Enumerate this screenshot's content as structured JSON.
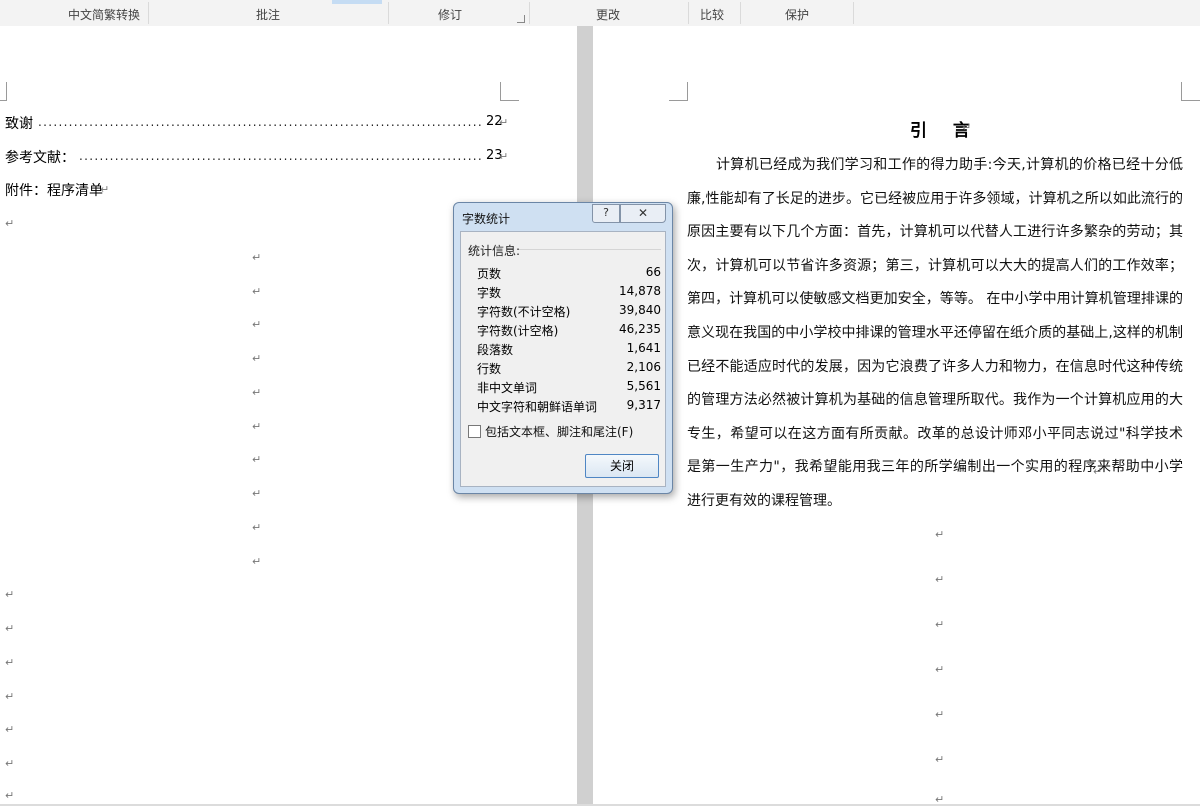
{
  "ribbon": {
    "groups": [
      "中文简繁转换",
      "批注",
      "修订",
      "更改",
      "比较",
      "保护"
    ]
  },
  "left_page": {
    "toc": [
      {
        "label": "致谢",
        "page": "22"
      },
      {
        "label": "参考文献：",
        "page": "23"
      }
    ],
    "appendix": "附件：程序清单",
    "para_mark": "↵"
  },
  "right_page": {
    "heading": "引  言",
    "para_mark": "↵",
    "body": "计算机已经成为我们学习和工作的得力助手:今天,计算机的价格已经十分低廉,性能却有了长足的进步。它已经被应用于许多领域，计算机之所以如此流行的原因主要有以下几个方面：首先，计算机可以代替人工进行许多繁杂的劳动；其次，计算机可以节省许多资源；第三，计算机可以大大的提高人们的工作效率；第四，计算机可以使敏感文档更加安全，等等。 在中小学中用计算机管理排课的意义现在我国的中小学校中排课的管理水平还停留在纸介质的基础上,这样的机制已经不能适应时代的发展，因为它浪费了许多人力和物力，在信息时代这种传统的管理方法必然被计算机为基础的信息管理所取代。我作为一个计算机应用的大专生，希望可以在这方面有所贡献。改革的总设计师邓小平同志说过\"科学技术是第一生产力\"，我希望能用我三年的所学编制出一个实用的程序来帮助中小学进行更有效的课程管理。"
  },
  "dialog": {
    "title": "字数统计",
    "help_icon": "?",
    "close_icon": "✕",
    "stats_label": "统计信息:",
    "stats": [
      {
        "label": "页数",
        "value": "66"
      },
      {
        "label": "字数",
        "value": "14,878"
      },
      {
        "label": "字符数(不计空格)",
        "value": "39,840"
      },
      {
        "label": "字符数(计空格)",
        "value": "46,235"
      },
      {
        "label": "段落数",
        "value": "1,641"
      },
      {
        "label": "行数",
        "value": "2,106"
      },
      {
        "label": "非中文单词",
        "value": "5,561"
      },
      {
        "label": "中文字符和朝鲜语单词",
        "value": "9,317"
      }
    ],
    "checkbox_label": "包括文本框、脚注和尾注(F)",
    "checkbox_checked": false,
    "close_button": "关闭"
  }
}
